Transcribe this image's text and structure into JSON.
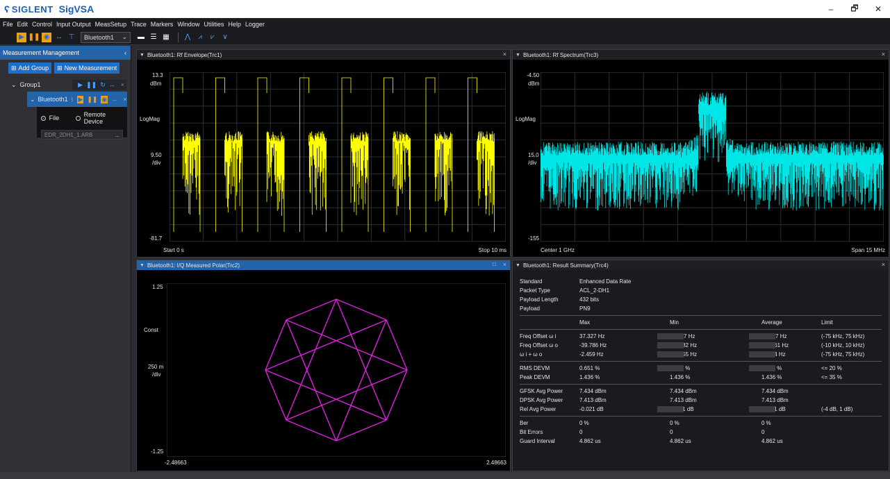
{
  "window": {
    "brand": "SIGLENT",
    "app_name": "SigVSA",
    "minimize": "–",
    "maximize": "🗗",
    "close": "✕"
  },
  "menu": [
    "File",
    "Edit",
    "Control",
    "Input Output",
    "MeasSetup",
    "Trace",
    "Markers",
    "Window",
    "Utilities",
    "Help",
    "Logger"
  ],
  "toolbar": {
    "measurement_select": "Bluetooth1",
    "icons": [
      "play-icon",
      "pause-icon",
      "single-icon",
      "continuous-icon",
      "trigger-icon",
      "layout-single-icon",
      "layout-rows-icon",
      "layout-grid-icon",
      "marker-icon",
      "peak-marker-icon",
      "next-peak-icon",
      "trace-marker-icon"
    ]
  },
  "sidebar": {
    "title": "Measurement Management",
    "add_group": "Add Group",
    "new_measurement": "New Measurement",
    "group": "Group1",
    "measurement": "Bluetooth1",
    "source_file": "File",
    "source_remote": "Remote Device",
    "file_name": "EDR_2DH1_1.ARB",
    "file_browse": "..."
  },
  "panels": {
    "envelope": {
      "title": "Bluetooth1: Rf Envelope(Trc1)",
      "y_top": "13.3",
      "y_top_unit": "dBm",
      "scale_mode": "LogMag",
      "y_div": "9.50",
      "y_div_unit": "/div",
      "y_bottom": "-81.7",
      "x_start": "Start  0 s",
      "x_stop": "Stop  10 ms",
      "trace_color": "#ffff00"
    },
    "spectrum": {
      "title": "Bluetooth1: Rf Spectrum(Trc3)",
      "y_top": "-4.50",
      "y_top_unit": "dBm",
      "scale_mode": "LogMag",
      "y_div": "15.0",
      "y_div_unit": "/div",
      "y_bottom": "-155",
      "x_center": "Center  1 GHz",
      "x_span": "Span  15 MHz",
      "trace_color": "#00e5e5"
    },
    "polar": {
      "title": "Bluetooth1: I/Q Measured Polar(Trc2)",
      "y_top": "1.25",
      "scale_mode": "Const",
      "y_div": "250 m",
      "y_div_unit": "/div",
      "y_bottom": "-1.25",
      "x_left": "-2.48663",
      "x_right": "2.48663",
      "trace_color": "#e020e0"
    },
    "summary": {
      "title": "Bluetooth1: Result Summary(Trc4)",
      "info": [
        {
          "k": "Standard",
          "v": "Enhanced Data Rate"
        },
        {
          "k": "Packet Type",
          "v": "ACL_2-DH1"
        },
        {
          "k": "Payload Length",
          "v": "432 bits"
        },
        {
          "k": "Payload",
          "v": "PN9"
        }
      ],
      "headers": [
        "",
        "Max",
        "Min",
        "Average",
        "Limit"
      ],
      "group1": [
        [
          "Freq Offset ω i",
          "37.327 Hz",
          "37.327 Hz",
          "37.327 Hz",
          "(-75 kHz, 75 kHz)"
        ],
        [
          "Freq Offset ω o",
          "-39.786 Hz",
          "-54.682 Hz",
          "-45.061 Hz",
          "(-10 kHz, 10 kHz)"
        ],
        [
          "ω i + ω o",
          "-2.459 Hz",
          "-17.355 Hz",
          "-7.734 Hz",
          "(-75 kHz, 75 kHz)"
        ]
      ],
      "group2": [
        [
          "RMS DEVM",
          "0.651 %",
          "0.443 %",
          "0.561 %",
          "<= 20 %"
        ],
        [
          "Peak DEVM",
          "1.436 %",
          "1.436 %",
          "1.436 %",
          "<= 35 %"
        ]
      ],
      "group3": [
        [
          "GFSK Avg Power",
          "7.434 dBm",
          "7.434 dBm",
          "7.434 dBm",
          ""
        ],
        [
          "DPSK Avg Power",
          "7.413 dBm",
          "7.413 dBm",
          "7.413 dBm",
          ""
        ],
        [
          "Rel Avg Power",
          "-0.021 dB",
          "-0.021 dB",
          "-0.021 dB",
          "(-4 dB, 1 dB)"
        ]
      ],
      "group4": [
        [
          "Ber",
          "0 %",
          "0 %",
          "0 %",
          ""
        ],
        [
          "Bit Errors",
          "0",
          "0",
          "0",
          ""
        ],
        [
          "Guard Interval",
          "4.862 us",
          "4.862 us",
          "4.862 us",
          ""
        ]
      ]
    }
  }
}
